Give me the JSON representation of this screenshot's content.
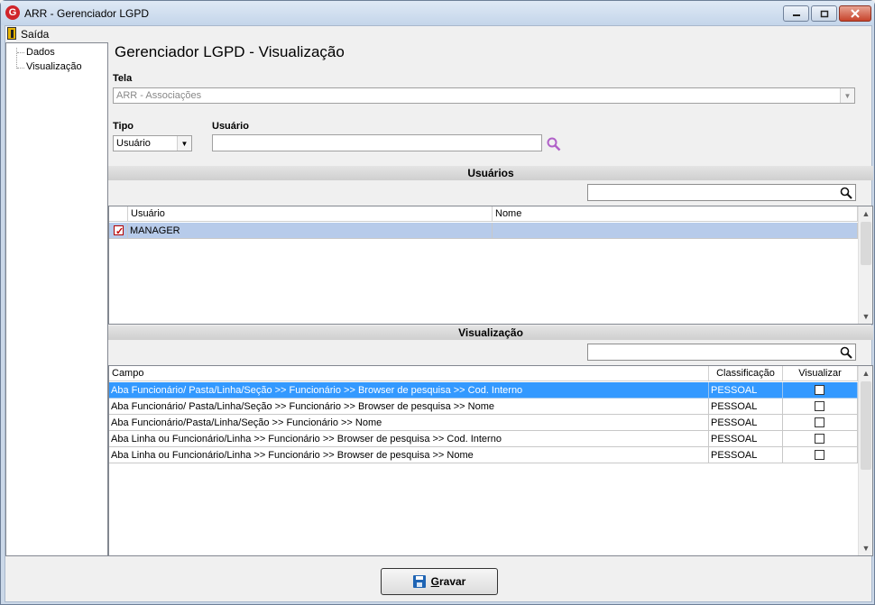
{
  "window": {
    "title": "ARR - Gerenciador LGPD",
    "app_icon": "G"
  },
  "menu": {
    "exit_label": "Saída"
  },
  "tree": {
    "items": [
      {
        "label": "Dados"
      },
      {
        "label": "Visualização"
      }
    ]
  },
  "page": {
    "title": "Gerenciador LGPD - Visualização"
  },
  "tela": {
    "label": "Tela",
    "value": "ARR - Associações"
  },
  "tipo": {
    "label": "Tipo",
    "value": "Usuário"
  },
  "usuario": {
    "label": "Usuário",
    "value": ""
  },
  "users_section": {
    "title": "Usuários",
    "columns": [
      "Usuário",
      "Nome"
    ],
    "rows": [
      {
        "checked": true,
        "usuario": "MANAGER",
        "nome": ""
      }
    ]
  },
  "view_section": {
    "title": "Visualização",
    "columns": [
      "Campo",
      "Classificação",
      "Visualizar"
    ],
    "rows": [
      {
        "campo": "Aba Funcionário/ Pasta/Linha/Seção >> Funcionário >> Browser de pesquisa >> Cod. Interno",
        "classificacao": "PESSOAL",
        "visualizar": false
      },
      {
        "campo": "Aba Funcionário/ Pasta/Linha/Seção >> Funcionário >> Browser de pesquisa >> Nome",
        "classificacao": "PESSOAL",
        "visualizar": false
      },
      {
        "campo": "Aba Funcionário/Pasta/Linha/Seção >> Funcionário >> Nome",
        "classificacao": "PESSOAL",
        "visualizar": false
      },
      {
        "campo": "Aba Linha ou Funcionário/Linha >> Funcionário >> Browser de pesquisa >> Cod. Interno",
        "classificacao": "PESSOAL",
        "visualizar": false
      },
      {
        "campo": "Aba Linha ou Funcionário/Linha >> Funcionário >> Browser de pesquisa >> Nome",
        "classificacao": "PESSOAL",
        "visualizar": false
      }
    ]
  },
  "save_button": {
    "label_accel": "G",
    "label_rest": "ravar"
  }
}
